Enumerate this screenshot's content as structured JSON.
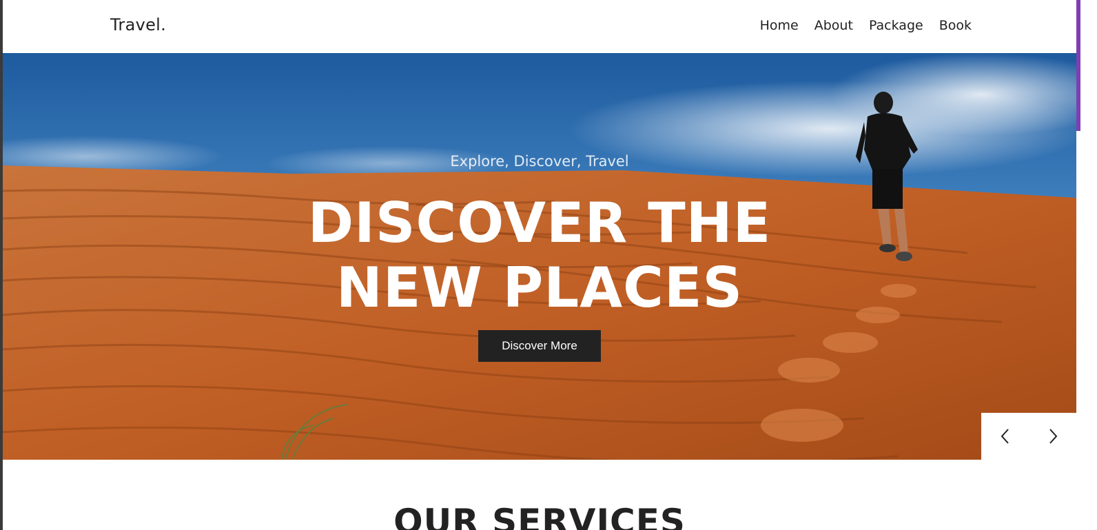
{
  "header": {
    "logo": "Travel.",
    "nav": [
      "Home",
      "About",
      "Package",
      "Book"
    ]
  },
  "hero": {
    "subtitle": "Explore, Discover, Travel",
    "title_line1": "DISCOVER THE",
    "title_line2": "NEW PLACES",
    "cta_label": "Discover More"
  },
  "slider": {
    "prev_icon": "chevron-left-icon",
    "next_icon": "chevron-right-icon"
  },
  "services": {
    "heading": "OUR SERVICES"
  },
  "colors": {
    "accent_scrollbar": "#7e3fb3",
    "button_bg": "#222222",
    "sand": "#c4652b",
    "sky": "#2b6cb0"
  }
}
